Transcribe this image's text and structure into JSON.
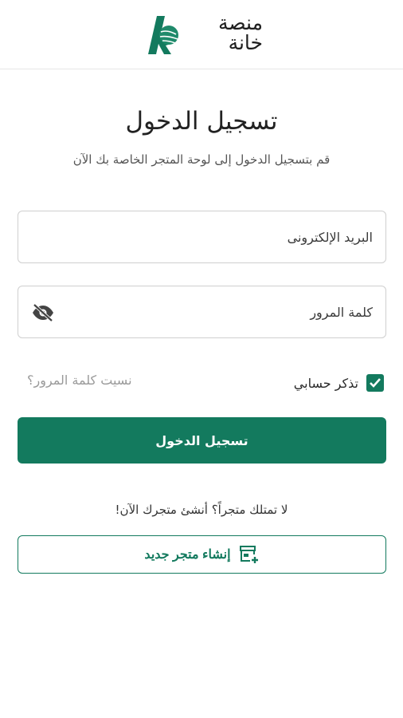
{
  "brand": {
    "logo_line1": "منصة",
    "logo_line2": "خانة",
    "logo_mark": "k",
    "accent_color": "#137a5e"
  },
  "login": {
    "title": "تسجيل الدخول",
    "subtitle": "قم بتسجيل الدخول إلى لوحة المتجر الخاصة بك الآن",
    "email_placeholder": "البريد الإلكترونى",
    "email_value": "",
    "password_placeholder": "كلمة المرور",
    "password_value": "",
    "password_toggle_icon": "eye-off-icon",
    "remember_label": "تذكر حسابي",
    "remember_checked": true,
    "forgot_link": "نسيت كلمة المرور؟",
    "submit_label": "تسجيل الدخول"
  },
  "signup": {
    "prompt": "لا تمتلك متجراً؟ أنشئ متجرك الآن!",
    "create_label": "إنشاء متجر جديد",
    "create_icon": "add-store-icon"
  }
}
